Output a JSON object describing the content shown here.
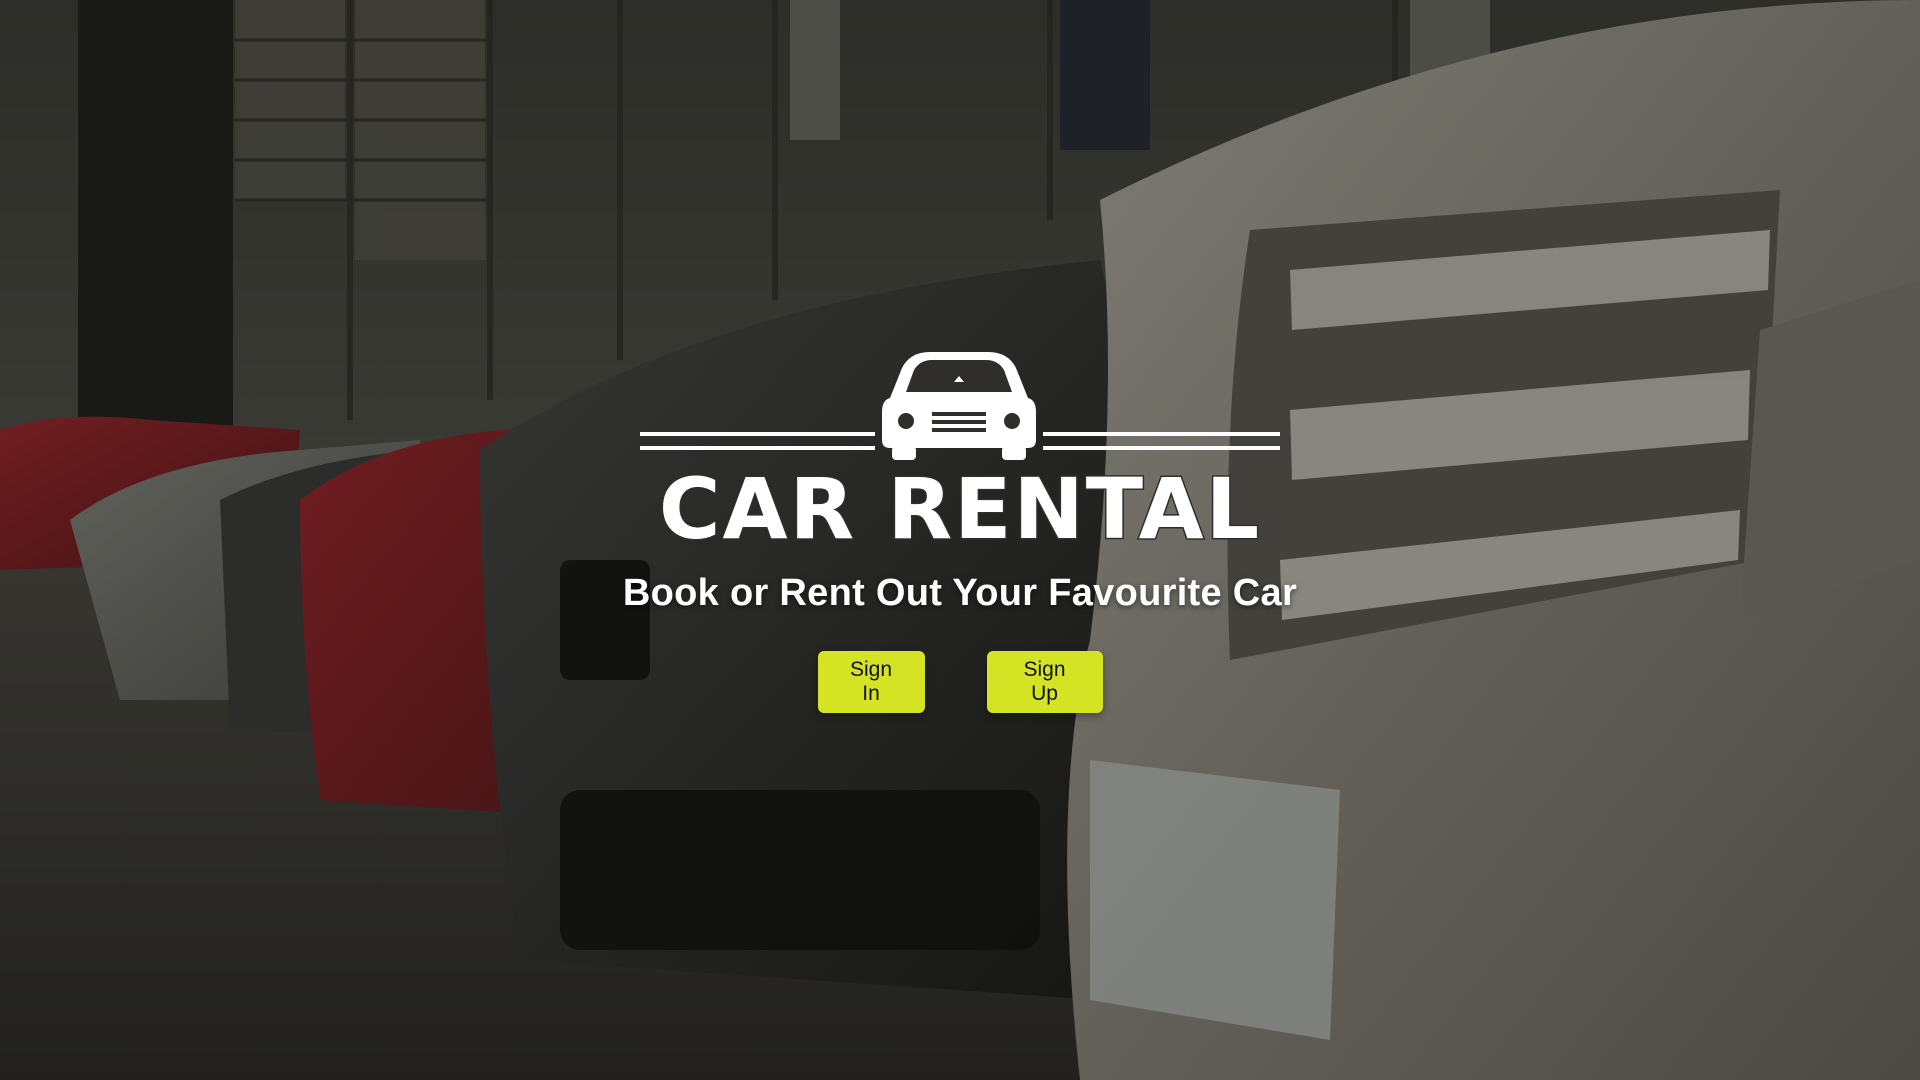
{
  "brand": {
    "logo_text": "CAR RENTAL",
    "logo_icon": "car-icon"
  },
  "hero": {
    "tagline": "Book or Rent Out Your Favourite Car",
    "background": "car-dealership-photo"
  },
  "actions": {
    "sign_in_label": "Sign In",
    "sign_up_label": "Sign Up"
  },
  "colors": {
    "accent": "#d4e323",
    "text": "#ffffff",
    "overlay": "#1a1a17"
  }
}
